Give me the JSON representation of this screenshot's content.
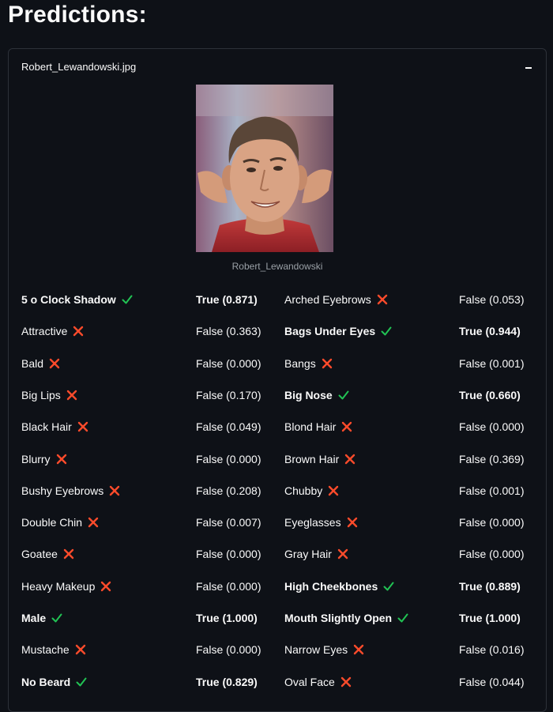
{
  "heading": "Predictions:",
  "expander": {
    "title": "Robert_Lewandowski.jpg",
    "image_caption": "Robert_Lewandowski"
  },
  "colors": {
    "true_mark": "#21c354",
    "false_mark": "#ff4b2b"
  },
  "predictions": [
    {
      "left": {
        "label": "5 o Clock Shadow",
        "value": "True (0.871)",
        "positive": true
      },
      "right": {
        "label": "Arched Eyebrows",
        "value": "False (0.053)",
        "positive": false
      }
    },
    {
      "left": {
        "label": "Attractive",
        "value": "False (0.363)",
        "positive": false
      },
      "right": {
        "label": "Bags Under Eyes",
        "value": "True (0.944)",
        "positive": true
      }
    },
    {
      "left": {
        "label": "Bald",
        "value": "False (0.000)",
        "positive": false
      },
      "right": {
        "label": "Bangs",
        "value": "False (0.001)",
        "positive": false
      }
    },
    {
      "left": {
        "label": "Big Lips",
        "value": "False (0.170)",
        "positive": false
      },
      "right": {
        "label": "Big Nose",
        "value": "True (0.660)",
        "positive": true
      }
    },
    {
      "left": {
        "label": "Black Hair",
        "value": "False (0.049)",
        "positive": false
      },
      "right": {
        "label": "Blond Hair",
        "value": "False (0.000)",
        "positive": false
      }
    },
    {
      "left": {
        "label": "Blurry",
        "value": "False (0.000)",
        "positive": false
      },
      "right": {
        "label": "Brown Hair",
        "value": "False (0.369)",
        "positive": false
      }
    },
    {
      "left": {
        "label": "Bushy Eyebrows",
        "value": "False (0.208)",
        "positive": false
      },
      "right": {
        "label": "Chubby",
        "value": "False (0.001)",
        "positive": false
      }
    },
    {
      "left": {
        "label": "Double Chin",
        "value": "False (0.007)",
        "positive": false
      },
      "right": {
        "label": "Eyeglasses",
        "value": "False (0.000)",
        "positive": false
      }
    },
    {
      "left": {
        "label": "Goatee",
        "value": "False (0.000)",
        "positive": false
      },
      "right": {
        "label": "Gray Hair",
        "value": "False (0.000)",
        "positive": false
      }
    },
    {
      "left": {
        "label": "Heavy Makeup",
        "value": "False (0.000)",
        "positive": false
      },
      "right": {
        "label": "High Cheekbones",
        "value": "True (0.889)",
        "positive": true
      }
    },
    {
      "left": {
        "label": "Male",
        "value": "True (1.000)",
        "positive": true
      },
      "right": {
        "label": "Mouth Slightly Open",
        "value": "True (1.000)",
        "positive": true
      }
    },
    {
      "left": {
        "label": "Mustache",
        "value": "False (0.000)",
        "positive": false
      },
      "right": {
        "label": "Narrow Eyes",
        "value": "False (0.016)",
        "positive": false
      }
    },
    {
      "left": {
        "label": "No Beard",
        "value": "True (0.829)",
        "positive": true
      },
      "right": {
        "label": "Oval Face",
        "value": "False (0.044)",
        "positive": false
      }
    }
  ]
}
